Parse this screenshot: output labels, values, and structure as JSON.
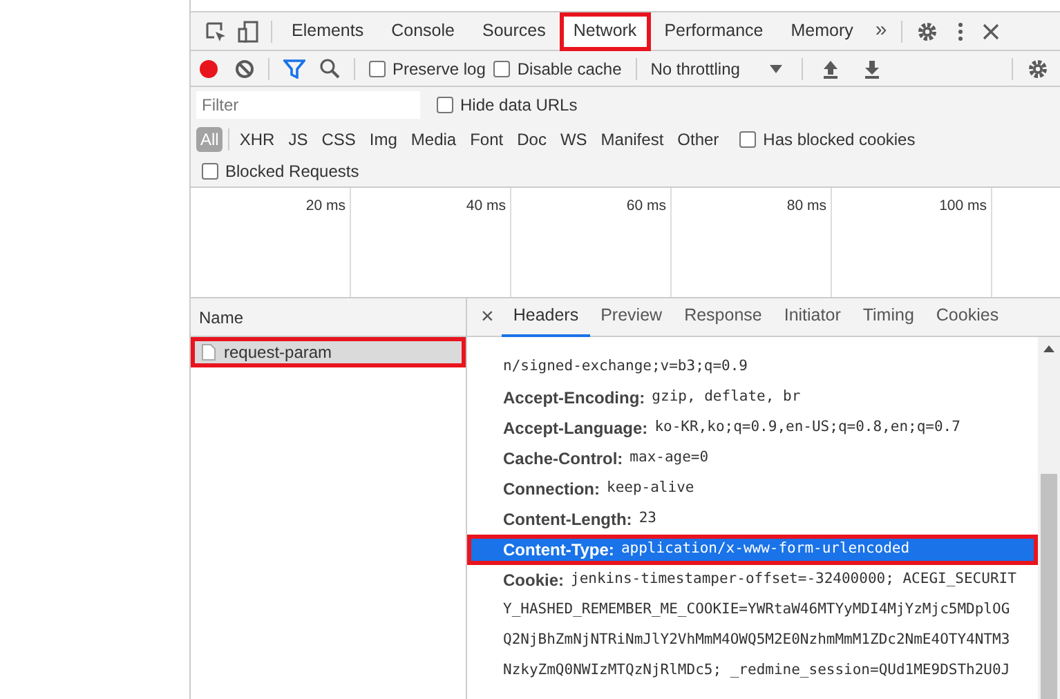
{
  "main_tabs": [
    {
      "label": "Elements",
      "selected": false,
      "highlighted": false
    },
    {
      "label": "Console",
      "selected": false,
      "highlighted": false
    },
    {
      "label": "Sources",
      "selected": false,
      "highlighted": false
    },
    {
      "label": "Network",
      "selected": true,
      "highlighted": true
    },
    {
      "label": "Performance",
      "selected": false,
      "highlighted": false
    },
    {
      "label": "Memory",
      "selected": false,
      "highlighted": false
    }
  ],
  "more_tabs": "»",
  "toolbar": {
    "recording": true,
    "preserve_log": {
      "label": "Preserve log",
      "checked": false
    },
    "disable_cache": {
      "label": "Disable cache",
      "checked": false
    },
    "throttling": "No throttling"
  },
  "filter": {
    "placeholder": "Filter",
    "hide_data_urls": {
      "label": "Hide data URLs",
      "checked": false
    }
  },
  "type_filters": [
    {
      "label": "All",
      "selected": true
    },
    {
      "label": "XHR",
      "selected": false
    },
    {
      "label": "JS",
      "selected": false
    },
    {
      "label": "CSS",
      "selected": false
    },
    {
      "label": "Img",
      "selected": false
    },
    {
      "label": "Media",
      "selected": false
    },
    {
      "label": "Font",
      "selected": false
    },
    {
      "label": "Doc",
      "selected": false
    },
    {
      "label": "WS",
      "selected": false
    },
    {
      "label": "Manifest",
      "selected": false
    },
    {
      "label": "Other",
      "selected": false
    }
  ],
  "has_blocked_cookies": {
    "label": "Has blocked cookies",
    "checked": false
  },
  "blocked_requests": {
    "label": "Blocked Requests",
    "checked": false
  },
  "timeline_ticks": [
    "20 ms",
    "40 ms",
    "60 ms",
    "80 ms",
    "100 ms"
  ],
  "name_column": "Name",
  "requests": [
    {
      "name": "request-param",
      "selected": true,
      "highlighted": true
    }
  ],
  "detail_close": "×",
  "detail_tabs": [
    {
      "label": "Headers",
      "selected": true
    },
    {
      "label": "Preview",
      "selected": false
    },
    {
      "label": "Response",
      "selected": false
    },
    {
      "label": "Initiator",
      "selected": false
    },
    {
      "label": "Timing",
      "selected": false
    },
    {
      "label": "Cookies",
      "selected": false
    }
  ],
  "header_lines": [
    {
      "value": "n/signed-exchange;v=b3;q=0.9",
      "selected": false,
      "highlighted": false
    },
    {
      "key": "Accept-Encoding:",
      "value": "gzip, deflate, br",
      "selected": false,
      "highlighted": false
    },
    {
      "key": "Accept-Language:",
      "value": "ko-KR,ko;q=0.9,en-US;q=0.8,en;q=0.7",
      "selected": false,
      "highlighted": false
    },
    {
      "key": "Cache-Control:",
      "value": "max-age=0",
      "selected": false,
      "highlighted": false
    },
    {
      "key": "Connection:",
      "value": "keep-alive",
      "selected": false,
      "highlighted": false
    },
    {
      "key": "Content-Length:",
      "value": "23",
      "selected": false,
      "highlighted": false
    },
    {
      "key": "Content-Type:",
      "value": "application/x-www-form-urlencoded",
      "selected": true,
      "highlighted": true
    },
    {
      "key": "Cookie:",
      "value": "jenkins-timestamper-offset=-32400000; ACEGI_SECURIT",
      "selected": false,
      "highlighted": false
    },
    {
      "value": "Y_HASHED_REMEMBER_ME_COOKIE=YWRtaW46MTYyMDI4MjYzMjc5MDplOG",
      "selected": false,
      "highlighted": false
    },
    {
      "value": "Q2NjBhZmNjNTRiNmJlY2VhMmM4OWQ5M2E0NzhmMmM1ZDc2NmE4OTY4NTM3",
      "selected": false,
      "highlighted": false
    },
    {
      "value": "NzkyZmQ0NWIzMTQzNjRlMDc5; _redmine_session=QUd1ME9DSTh2U0J",
      "selected": false,
      "highlighted": false
    }
  ]
}
